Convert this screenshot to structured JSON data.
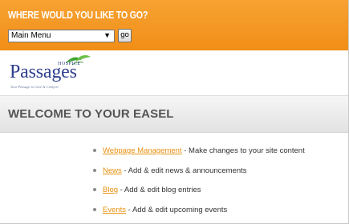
{
  "nav": {
    "title": "WHERE WOULD YOU LIKE TO GO?",
    "select_value": "Main Menu",
    "go_label": "go",
    "accent_color": "#f39a22"
  },
  "logo": {
    "word": "Passages",
    "sub": "HOSPICE",
    "tagline": "Your Passage to Care & Comfort",
    "color": "#2f3f8e"
  },
  "welcome": {
    "title": "WELCOME TO YOUR EASEL"
  },
  "links": [
    {
      "label": "Webpage Management",
      "description": " - Make changes to your site content"
    },
    {
      "label": "News",
      "description": " - Add & edit news & announcements"
    },
    {
      "label": "Blog",
      "description": " - Add & edit blog entries"
    },
    {
      "label": "Events",
      "description": " - Add & edit upcoming events"
    }
  ],
  "link_color": "#e8900f"
}
